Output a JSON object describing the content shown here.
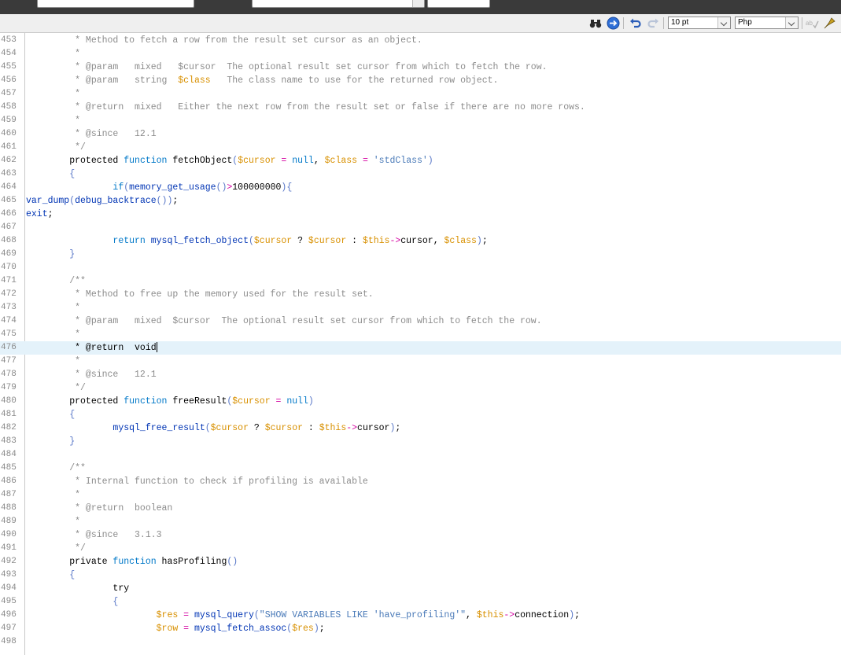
{
  "toolbar": {
    "font_size": "10 pt",
    "language": "Php"
  },
  "editor": {
    "lines": [
      {
        "n": "453",
        "segs": [
          [
            "cm",
            "         * Method to fetch a row from the result set cursor as an object."
          ]
        ]
      },
      {
        "n": "454",
        "segs": [
          [
            "cm",
            "         *"
          ]
        ]
      },
      {
        "n": "455",
        "segs": [
          [
            "cm",
            "         * @param   mixed   $cursor  The optional result set cursor from which to fetch the row."
          ]
        ]
      },
      {
        "n": "456",
        "segs": [
          [
            "cm",
            "         * @param   string  "
          ],
          [
            "var",
            "$class"
          ],
          [
            "cm",
            "   The class name to use for the returned row object."
          ]
        ]
      },
      {
        "n": "457",
        "segs": [
          [
            "cm",
            "         *"
          ]
        ]
      },
      {
        "n": "458",
        "segs": [
          [
            "cm",
            "         * @return  mixed   Either the next row from the result set or false if there are no more rows."
          ]
        ]
      },
      {
        "n": "459",
        "segs": [
          [
            "cm",
            "         *"
          ]
        ]
      },
      {
        "n": "460",
        "segs": [
          [
            "cm",
            "         * @since   12.1"
          ]
        ]
      },
      {
        "n": "461",
        "segs": [
          [
            "cm",
            "         */"
          ]
        ]
      },
      {
        "n": "462",
        "segs": [
          [
            "",
            "        protected "
          ],
          [
            "kw",
            "function"
          ],
          [
            "",
            " fetchObject"
          ],
          [
            "br",
            "("
          ],
          [
            "var",
            "$cursor"
          ],
          [
            "op",
            " = "
          ],
          [
            "kw",
            "null"
          ],
          [
            "",
            ", "
          ],
          [
            "var",
            "$class"
          ],
          [
            "op",
            " = "
          ],
          [
            "str",
            "'stdClass'"
          ],
          [
            "br",
            ")"
          ]
        ]
      },
      {
        "n": "463",
        "segs": [
          [
            "br",
            "        {"
          ]
        ]
      },
      {
        "n": "464",
        "segs": [
          [
            "",
            "                "
          ],
          [
            "kw",
            "if"
          ],
          [
            "br",
            "("
          ],
          [
            "fn",
            "memory_get_usage"
          ],
          [
            "br",
            "()"
          ],
          [
            "op",
            ">"
          ],
          [
            "num",
            "100000000"
          ],
          [
            "br",
            ")"
          ],
          [
            "br",
            "{"
          ]
        ]
      },
      {
        "n": "465",
        "segs": [
          [
            "fn",
            "var_dump"
          ],
          [
            "br",
            "("
          ],
          [
            "fn",
            "debug_backtrace"
          ],
          [
            "br",
            "())"
          ],
          [
            "",
            ";"
          ]
        ]
      },
      {
        "n": "466",
        "segs": [
          [
            "fn",
            "exit"
          ],
          [
            "",
            ";"
          ]
        ]
      },
      {
        "n": "467",
        "segs": [
          [
            "",
            ""
          ]
        ]
      },
      {
        "n": "468",
        "segs": [
          [
            "",
            "                "
          ],
          [
            "kw",
            "return"
          ],
          [
            "",
            " "
          ],
          [
            "fn",
            "mysql_fetch_object"
          ],
          [
            "br",
            "("
          ],
          [
            "var",
            "$cursor"
          ],
          [
            "",
            " ? "
          ],
          [
            "var",
            "$cursor"
          ],
          [
            "",
            " : "
          ],
          [
            "var",
            "$this"
          ],
          [
            "op",
            "->"
          ],
          [
            "",
            "cursor, "
          ],
          [
            "var",
            "$class"
          ],
          [
            "br",
            ")"
          ],
          [
            "",
            ";"
          ]
        ]
      },
      {
        "n": "469",
        "segs": [
          [
            "br",
            "        }"
          ]
        ]
      },
      {
        "n": "470",
        "segs": [
          [
            "",
            ""
          ]
        ]
      },
      {
        "n": "471",
        "segs": [
          [
            "cm",
            "        /**"
          ]
        ]
      },
      {
        "n": "472",
        "segs": [
          [
            "cm",
            "         * Method to free up the memory used for the result set."
          ]
        ]
      },
      {
        "n": "473",
        "segs": [
          [
            "cm",
            "         *"
          ]
        ]
      },
      {
        "n": "474",
        "segs": [
          [
            "cm",
            "         * @param   mixed  $cursor  The optional result set cursor from which to fetch the row."
          ]
        ]
      },
      {
        "n": "475",
        "segs": [
          [
            "cm",
            "         *"
          ]
        ]
      },
      {
        "n": "476",
        "active": true,
        "segs": [
          [
            "",
            "         * @return  void"
          ]
        ]
      },
      {
        "n": "477",
        "segs": [
          [
            "cm",
            "         *"
          ]
        ]
      },
      {
        "n": "478",
        "segs": [
          [
            "cm",
            "         * @since   12.1"
          ]
        ]
      },
      {
        "n": "479",
        "segs": [
          [
            "cm",
            "         */"
          ]
        ]
      },
      {
        "n": "480",
        "segs": [
          [
            "",
            "        protected "
          ],
          [
            "kw",
            "function"
          ],
          [
            "",
            " freeResult"
          ],
          [
            "br",
            "("
          ],
          [
            "var",
            "$cursor"
          ],
          [
            "op",
            " = "
          ],
          [
            "kw",
            "null"
          ],
          [
            "br",
            ")"
          ]
        ]
      },
      {
        "n": "481",
        "segs": [
          [
            "br",
            "        {"
          ]
        ]
      },
      {
        "n": "482",
        "segs": [
          [
            "",
            "                "
          ],
          [
            "fn",
            "mysql_free_result"
          ],
          [
            "br",
            "("
          ],
          [
            "var",
            "$cursor"
          ],
          [
            "",
            " ? "
          ],
          [
            "var",
            "$cursor"
          ],
          [
            "",
            " : "
          ],
          [
            "var",
            "$this"
          ],
          [
            "op",
            "->"
          ],
          [
            "",
            "cursor"
          ],
          [
            "br",
            ")"
          ],
          [
            "",
            ";"
          ]
        ]
      },
      {
        "n": "483",
        "segs": [
          [
            "br",
            "        }"
          ]
        ]
      },
      {
        "n": "484",
        "segs": [
          [
            "",
            ""
          ]
        ]
      },
      {
        "n": "485",
        "segs": [
          [
            "cm",
            "        /**"
          ]
        ]
      },
      {
        "n": "486",
        "segs": [
          [
            "cm",
            "         * Internal function to check if profiling is available"
          ]
        ]
      },
      {
        "n": "487",
        "segs": [
          [
            "cm",
            "         *"
          ]
        ]
      },
      {
        "n": "488",
        "segs": [
          [
            "cm",
            "         * @return  boolean"
          ]
        ]
      },
      {
        "n": "489",
        "segs": [
          [
            "cm",
            "         *"
          ]
        ]
      },
      {
        "n": "490",
        "segs": [
          [
            "cm",
            "         * @since   3.1.3"
          ]
        ]
      },
      {
        "n": "491",
        "segs": [
          [
            "cm",
            "         */"
          ]
        ]
      },
      {
        "n": "492",
        "segs": [
          [
            "",
            "        private "
          ],
          [
            "kw",
            "function"
          ],
          [
            "",
            " hasProfiling"
          ],
          [
            "br",
            "()"
          ]
        ]
      },
      {
        "n": "493",
        "segs": [
          [
            "br",
            "        {"
          ]
        ]
      },
      {
        "n": "494",
        "segs": [
          [
            "",
            "                try"
          ]
        ]
      },
      {
        "n": "495",
        "segs": [
          [
            "br",
            "                {"
          ]
        ]
      },
      {
        "n": "496",
        "segs": [
          [
            "",
            "                        "
          ],
          [
            "var",
            "$res"
          ],
          [
            "op",
            " = "
          ],
          [
            "fn",
            "mysql_query"
          ],
          [
            "br",
            "("
          ],
          [
            "str",
            "\"SHOW VARIABLES LIKE 'have_profiling'\""
          ],
          [
            "",
            ", "
          ],
          [
            "var",
            "$this"
          ],
          [
            "op",
            "->"
          ],
          [
            "",
            "connection"
          ],
          [
            "br",
            ")"
          ],
          [
            "",
            ";"
          ]
        ]
      },
      {
        "n": "497",
        "segs": [
          [
            "",
            "                        "
          ],
          [
            "var",
            "$row"
          ],
          [
            "op",
            " = "
          ],
          [
            "fn",
            "mysql_fetch_assoc"
          ],
          [
            "br",
            "("
          ],
          [
            "var",
            "$res"
          ],
          [
            "br",
            ")"
          ],
          [
            "",
            ";"
          ]
        ]
      },
      {
        "n": "498",
        "segs": [
          [
            "",
            ""
          ]
        ]
      }
    ]
  }
}
